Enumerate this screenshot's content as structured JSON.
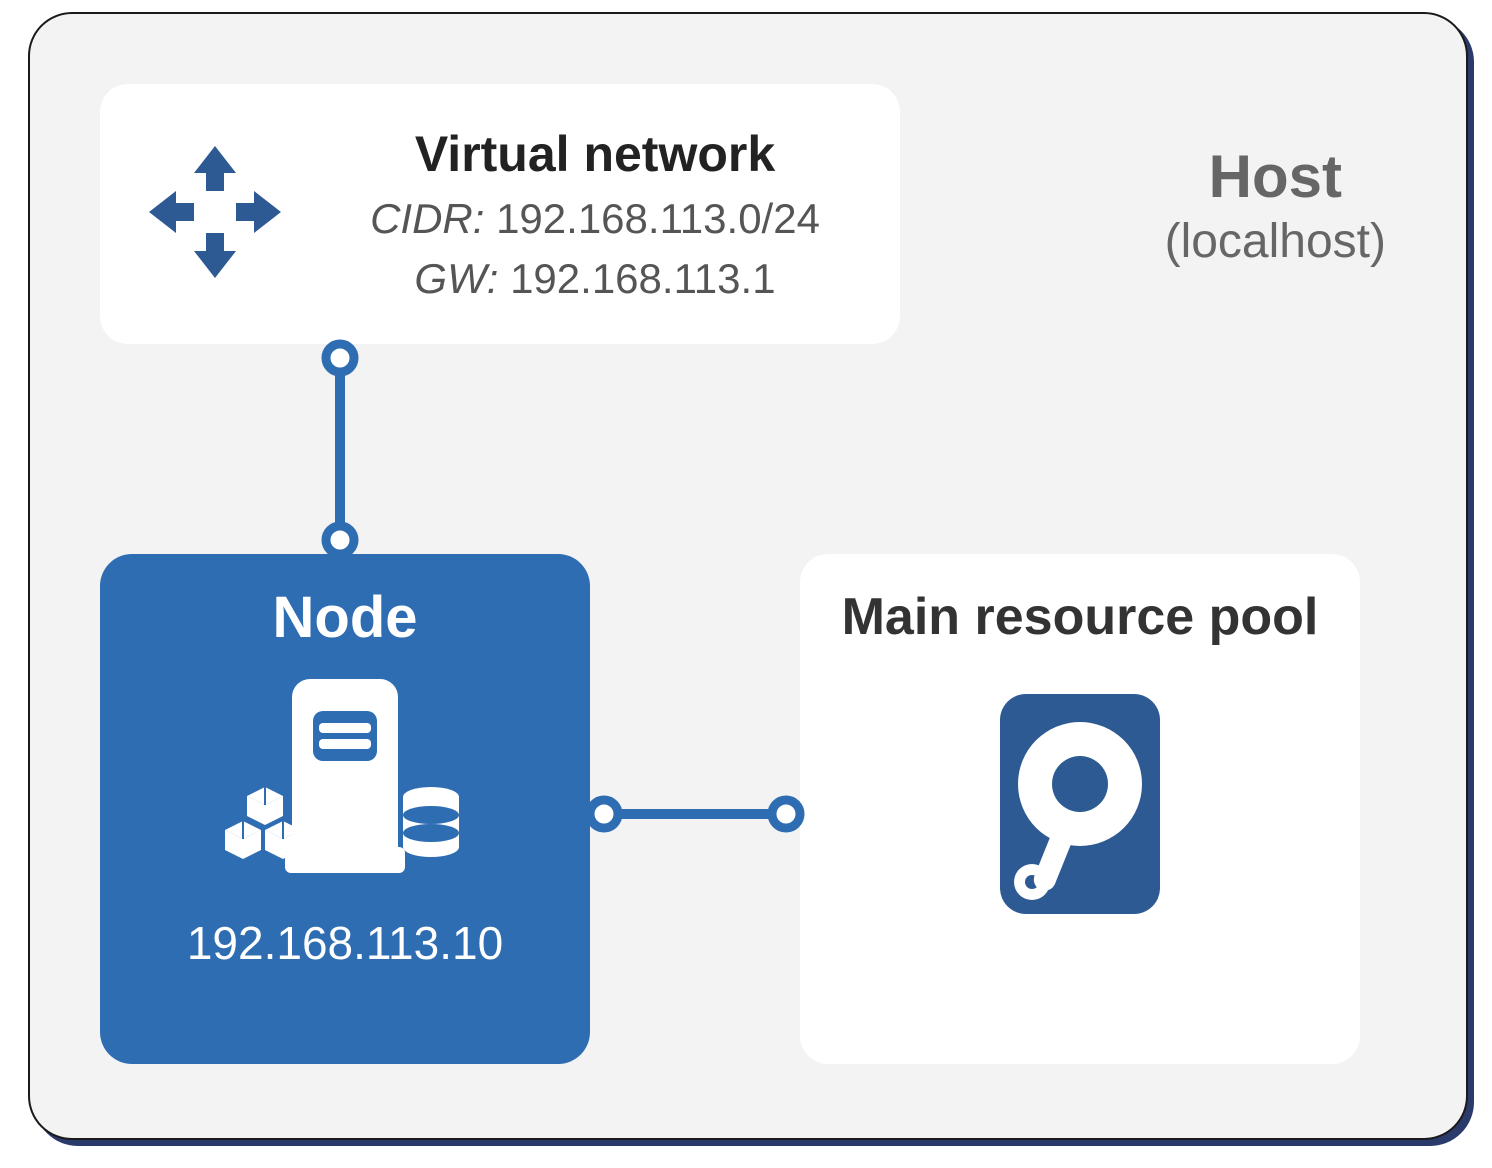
{
  "host": {
    "title": "Host",
    "subtitle": "(localhost)"
  },
  "virtual_network": {
    "title": "Virtual network",
    "cidr_label": "CIDR:",
    "cidr_value": "192.168.113.0/24",
    "gw_label": "GW:",
    "gw_value": "192.168.113.1"
  },
  "node": {
    "title": "Node",
    "ip": "192.168.113.10"
  },
  "resource_pool": {
    "title": "Main resource pool"
  },
  "colors": {
    "accent": "#2f6db3",
    "icon_dark": "#2e5a94",
    "panel_bg": "#f3f3f3"
  }
}
